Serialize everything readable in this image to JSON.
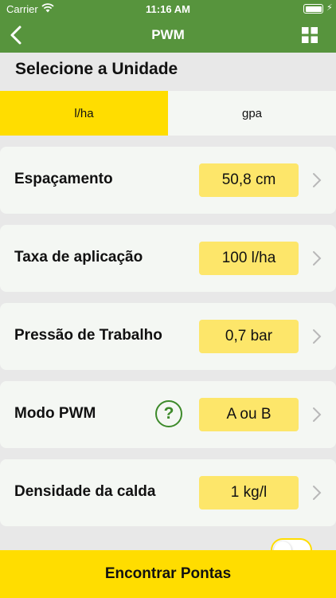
{
  "status_bar": {
    "carrier": "Carrier",
    "time": "11:16 AM",
    "icons": [
      "wifi-icon",
      "battery-icon",
      "charging-bolt-icon"
    ]
  },
  "nav": {
    "title": "PWM",
    "back_icon": "chevron-left-icon",
    "menu_icon": "grid-icon"
  },
  "unit_section": {
    "title": "Selecione a Unidade",
    "options": [
      {
        "label": "l/ha",
        "selected": true
      },
      {
        "label": "gpa",
        "selected": false
      }
    ]
  },
  "rows": [
    {
      "label": "Espaçamento",
      "value": "50,8 cm"
    },
    {
      "label": "Taxa de aplicação",
      "value": "100 l/ha"
    },
    {
      "label": "Pressão de Trabalho",
      "value": "0,7 bar"
    },
    {
      "label": "Modo PWM",
      "value": "A ou B",
      "help": "?"
    },
    {
      "label": "Densidade da calda",
      "value": "1 kg/l"
    }
  ],
  "toggle": {
    "on": false
  },
  "footer": {
    "button_label": "Encontrar Pontas"
  },
  "colors": {
    "header_green": "#57943d",
    "accent_yellow": "#ffdd00",
    "value_yellow": "#fde66a",
    "help_green": "#3d8a2a",
    "card_bg": "#f4f7f3",
    "page_bg": "#e8e8e8"
  }
}
